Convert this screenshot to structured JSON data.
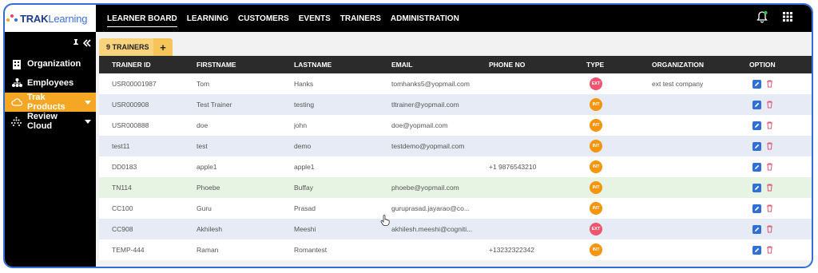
{
  "app": {
    "logo_part1": "TRAK",
    "logo_part2": "Learning",
    "colors": {
      "accent": "#f5a623",
      "header": "#000000",
      "frame": "#2f6fd6",
      "int": "#f5950b",
      "ext": "#f0556f",
      "edit": "#2f6fd6",
      "delete": "#e05572"
    }
  },
  "sidebar": {
    "items": [
      {
        "label": "Organization",
        "icon": "building-icon"
      },
      {
        "label": "Employees",
        "icon": "org-chart-icon"
      },
      {
        "label": "Trak Products",
        "icon": "cloud-icon",
        "active": true
      },
      {
        "label": "Review Cloud",
        "icon": "dots-grid-icon"
      }
    ]
  },
  "topnav": {
    "items": [
      "LEARNER BOARD",
      "LEARNING",
      "CUSTOMERS",
      "EVENTS",
      "TRAINERS",
      "ADMINISTRATION"
    ],
    "active": "LEARNER BOARD"
  },
  "tab": {
    "label": "9 TRAINERS",
    "add": "+"
  },
  "table": {
    "headers": [
      "TRAINER ID",
      "FIRSTNAME",
      "LASTNAME",
      "EMAIL",
      "PHONE NO",
      "TYPE",
      "ORGANIZATION",
      "OPTION"
    ],
    "rows": [
      {
        "id": "USR00001987",
        "first": "Tom",
        "last": "Hanks",
        "email": "tomhanks5@yopmail.com",
        "phone": "",
        "type": "EXT",
        "org": "ext test company"
      },
      {
        "id": "USR000908",
        "first": "Test Trainer",
        "last": "testing",
        "email": "tltrainer@yopmail.com",
        "phone": "",
        "type": "INT",
        "org": ""
      },
      {
        "id": "USR000888",
        "first": "doe",
        "last": "john",
        "email": "doe@yopmail.com",
        "phone": "",
        "type": "INT",
        "org": ""
      },
      {
        "id": "test11",
        "first": "test",
        "last": "demo",
        "email": "testdemo@yopmail.com",
        "phone": "",
        "type": "INT",
        "org": ""
      },
      {
        "id": "DD0183",
        "first": "apple1",
        "last": "apple1",
        "email": "",
        "phone": "+1 9876543210",
        "type": "INT",
        "org": ""
      },
      {
        "id": "TN114",
        "first": "Phoebe",
        "last": "Buffay",
        "email": "phoebe@yopmail.com",
        "phone": "",
        "type": "INT",
        "org": ""
      },
      {
        "id": "CC100",
        "first": "Guru",
        "last": "Prasad",
        "email": "guruprasad.jayarao@co...",
        "phone": "",
        "type": "INT",
        "org": ""
      },
      {
        "id": "CC908",
        "first": "Akhilesh",
        "last": "Meeshi",
        "email": "akhilesh.meeshi@cogniti...",
        "phone": "",
        "type": "EXT",
        "org": ""
      },
      {
        "id": "TEMP-444",
        "first": "Raman",
        "last": "Romantest",
        "email": "",
        "phone": "+13232322342",
        "type": "INT",
        "org": ""
      }
    ]
  }
}
